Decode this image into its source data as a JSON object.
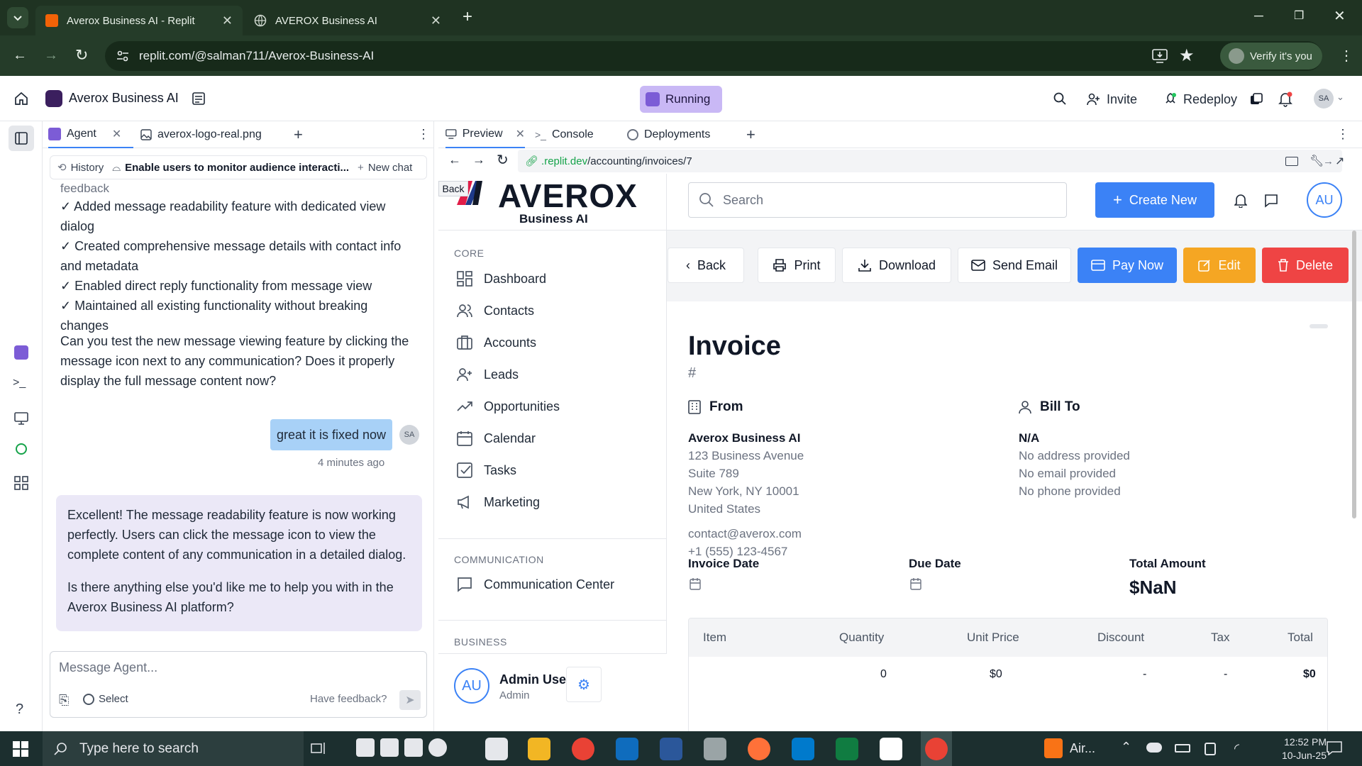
{
  "browser": {
    "tabs": [
      {
        "title": "Averox Business AI - Replit"
      },
      {
        "title": "AVEROX Business AI"
      }
    ],
    "url": "replit.com/@salman711/Averox-Business-AI",
    "verify_label": "Verify it's you"
  },
  "replit": {
    "project_name": "Averox Business AI",
    "status": "Running",
    "invite_label": "Invite",
    "redeploy_label": "Redeploy",
    "avatar_initials": "SA",
    "left_tabs": [
      {
        "label": "Agent"
      },
      {
        "label": "averox-logo-real.png"
      }
    ],
    "right_tabs": [
      {
        "label": "Preview"
      },
      {
        "label": "Console"
      },
      {
        "label": "Deployments"
      }
    ],
    "preview_url_host": ".replit.dev",
    "preview_url_path": "/accounting/invoices/7",
    "back_tooltip": "Back"
  },
  "agent": {
    "history_label": "History",
    "thread_title": "Enable users to monitor audience interacti...",
    "new_chat_label": "New chat",
    "partial_text": "feedback",
    "checklist": [
      "✓ Added message readability feature with dedicated view dialog",
      "✓ Created comprehensive message details with contact info and metadata",
      "✓ Enabled direct reply functionality from message view",
      "✓ Maintained all existing functionality without breaking changes"
    ],
    "question": "Can you test the new message viewing feature by clicking the message icon next to any communication? Does it properly display the full message content now?",
    "user_message": "great it is fixed now",
    "user_initials": "SA",
    "user_time": "4 minutes ago",
    "reply_p1": "Excellent! The message readability feature is now working perfectly. Users can click the message icon to view the complete content of any communication in a detailed dialog.",
    "reply_p2": "Is there anything else you'd like me to help you with in the Averox Business AI platform?",
    "input_placeholder": "Message Agent...",
    "select_label": "Select",
    "feedback_label": "Have feedback?"
  },
  "app": {
    "logo_text": "AVEROX",
    "logo_sub": "Business AI",
    "search_placeholder": "Search",
    "create_new_label": "Create New",
    "user_initials": "AU",
    "sections": {
      "core": "CORE",
      "communication": "COMMUNICATION",
      "business": "BUSINESS"
    },
    "nav": [
      {
        "label": "Dashboard",
        "icon": "dashboard-icon"
      },
      {
        "label": "Contacts",
        "icon": "contacts-icon"
      },
      {
        "label": "Accounts",
        "icon": "accounts-icon"
      },
      {
        "label": "Leads",
        "icon": "leads-icon"
      },
      {
        "label": "Opportunities",
        "icon": "opportunities-icon"
      },
      {
        "label": "Calendar",
        "icon": "calendar-icon"
      },
      {
        "label": "Tasks",
        "icon": "tasks-icon"
      },
      {
        "label": "Marketing",
        "icon": "marketing-icon"
      }
    ],
    "comm_nav": {
      "label": "Communication Center"
    },
    "admin": {
      "name": "Admin User",
      "role": "Admin",
      "initials": "AU"
    },
    "actions": {
      "back": "Back",
      "print": "Print",
      "download": "Download",
      "send_email": "Send Email",
      "pay_now": "Pay Now",
      "edit": "Edit",
      "delete": "Delete"
    },
    "invoice": {
      "title": "Invoice",
      "number": "#",
      "from_label": "From",
      "bill_to_label": "Bill To",
      "from_name": "Averox Business AI",
      "from_address": [
        "123 Business Avenue",
        "Suite 789",
        "New York, NY 10001",
        "United States"
      ],
      "from_email": "contact@averox.com",
      "from_phone": "+1 (555) 123-4567",
      "bill_name": "N/A",
      "bill_lines": [
        "No address provided",
        "No email provided",
        "No phone provided"
      ],
      "invoice_date_label": "Invoice Date",
      "due_date_label": "Due Date",
      "total_label": "Total Amount",
      "total_value": "$NaN",
      "table_headers": [
        "Item",
        "Quantity",
        "Unit Price",
        "Discount",
        "Tax",
        "Total"
      ],
      "row": [
        "",
        "0",
        "$0",
        "-",
        "-",
        "$0"
      ]
    },
    "colors": {
      "primary": "#3b82f6",
      "edit": "#f5a623",
      "delete": "#ef4444"
    }
  },
  "taskbar": {
    "search_placeholder": "Type here to search",
    "weather": "Air...",
    "time": "12:52 PM",
    "date": "10-Jun-25"
  }
}
